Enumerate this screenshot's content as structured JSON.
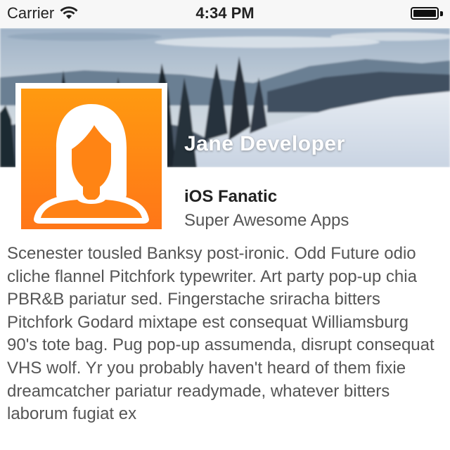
{
  "status_bar": {
    "carrier": "Carrier",
    "time": "4:34 PM",
    "wifi_icon": "wifi-icon",
    "battery_icon": "battery-icon",
    "battery_level": 1.0
  },
  "profile": {
    "name": "Jane Developer",
    "title": "iOS Fanatic",
    "company": "Super Awesome Apps",
    "avatar_icon": "person-avatar-icon",
    "avatar_color": "#ff8712",
    "bio": "Scenester tousled Banksy post-ironic. Odd Future odio cliche flannel Pitchfork typewriter. Art party pop-up chia PBR&B pariatur sed. Fingerstache sriracha bitters Pitchfork Godard mixtape est consequat Williamsburg 90's tote bag. Pug pop-up assumenda, disrupt consequat VHS wolf. Yr you probably haven't heard of them fixie dreamcatcher pariatur readymade, whatever bitters laborum fugiat ex"
  }
}
